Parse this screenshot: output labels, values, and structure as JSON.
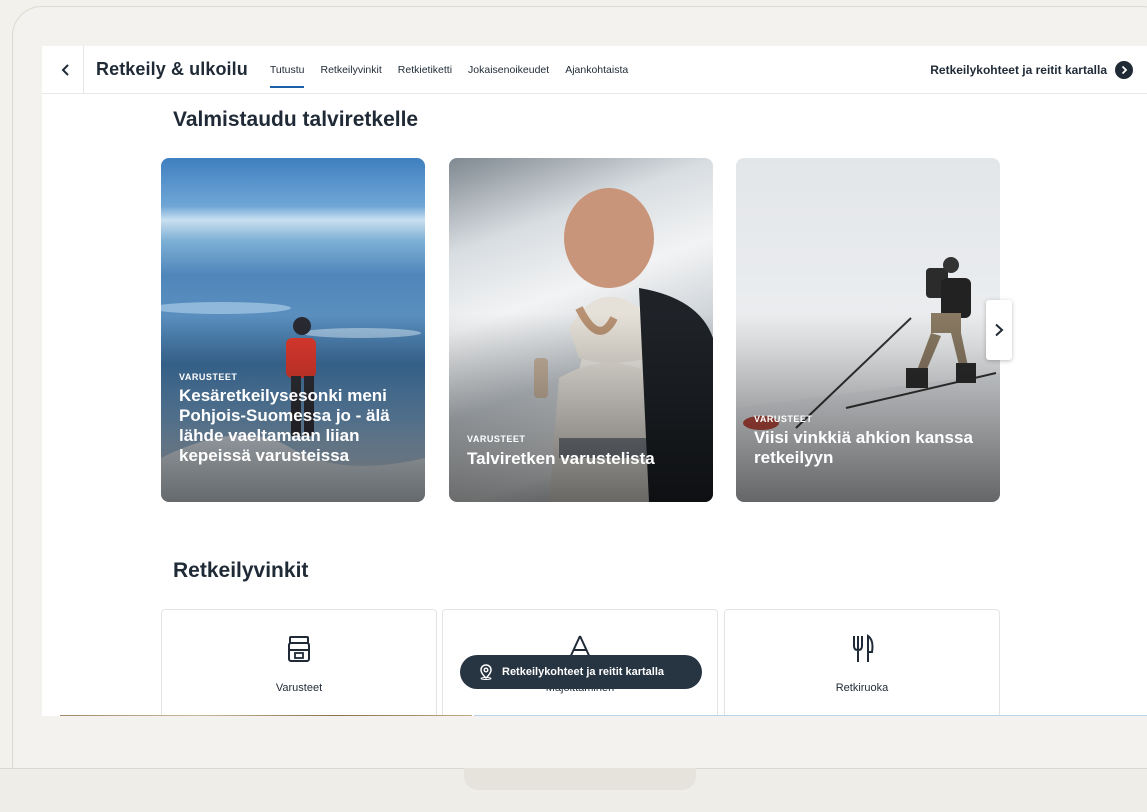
{
  "nav": {
    "brand": "Retkeily & ulkoilu",
    "tabs": [
      {
        "label": "Tutustu",
        "active": true
      },
      {
        "label": "Retkeilyvinkit",
        "active": false
      },
      {
        "label": "Retkietiketti",
        "active": false
      },
      {
        "label": "Jokaisenoikeudet",
        "active": false
      },
      {
        "label": "Ajankohtaista",
        "active": false
      }
    ],
    "map_link": "Retkeilykohteet ja reitit kartalla"
  },
  "section1": {
    "title": "Valmistaudu talviretkelle",
    "cards": [
      {
        "category": "VARUSTEET",
        "title": "Kesäretkeilysesonki meni Pohjois-Suomessa jo - älä lähde vaeltamaan liian kepeissä varusteissa"
      },
      {
        "category": "VARUSTEET",
        "title": "Talviretken varustelista"
      },
      {
        "category": "VARUSTEET",
        "title": "Viisi vinkkiä ahkion kanssa retkeilyyn"
      }
    ]
  },
  "section2": {
    "title": "Retkeilyvinkit",
    "tips": [
      {
        "label": "Varusteet",
        "icon": "backpack-icon"
      },
      {
        "label": "Majoittaminen",
        "icon": "tent-icon"
      },
      {
        "label": "Retkiruoka",
        "icon": "fork-knife-icon"
      }
    ]
  },
  "floating_button": {
    "label": "Retkeilykohteet ja reitit kartalla",
    "icon": "map-pin-icon"
  },
  "colors": {
    "accent": "#1b5fa8",
    "dark": "#1f2a36"
  }
}
